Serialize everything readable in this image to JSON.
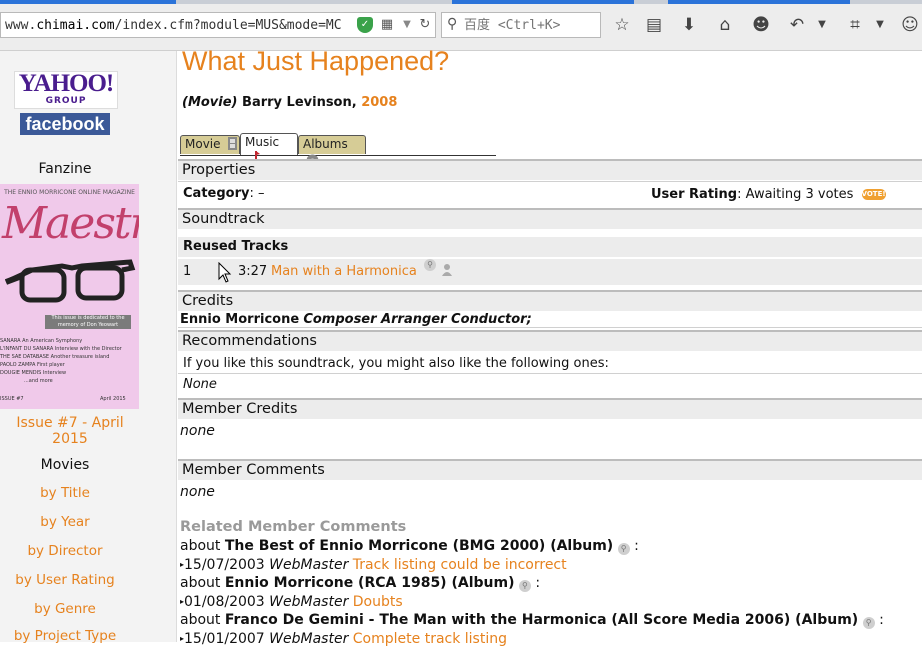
{
  "browser": {
    "url_prefix": "www.",
    "url_domain": "chimai.com",
    "url_rest": "/index.cfm?module=MUS&mode=MC",
    "search_placeholder": "百度 <Ctrl+K>",
    "search_icon": "search-icon"
  },
  "sidebar": {
    "yahoo_text": "YAHOO!",
    "yahoo_sub": "GROUP",
    "facebook_text": "facebook",
    "fanzine_title": "Fanzine",
    "cover": {
      "head": "THE ENNIO MORRICONE ONLINE MAGAZINE",
      "title": "Maestro",
      "box_text": "This issue is dedicated to the memory of Don Yeowart",
      "lines": [
        "SANARA An American Symphony",
        "L'INFANT DU SANARA Interview with the Director",
        "THE SAE DATABASE Another treasure island",
        "PAOLO ZAMPA First player",
        "DOUGIE MENDIS Interview"
      ],
      "more": "...and more",
      "issue": "ISSUE #7",
      "date": "April 2015"
    },
    "issue_link": "Issue #7 - April 2015",
    "movies_title": "Movies",
    "movies_links": [
      "by Title",
      "by Year",
      "by Director",
      "by User Rating",
      "by Genre",
      "by Project Type"
    ]
  },
  "main": {
    "title": "What Just Happened?",
    "kind": "(Movie)",
    "director": "Barry Levinson,",
    "year": "2008",
    "tabs": [
      {
        "label": "Movie",
        "active": false
      },
      {
        "label": "Music",
        "active": true
      },
      {
        "label": "Albums",
        "active": false
      }
    ],
    "properties": {
      "header": "Properties",
      "category_label": "Category",
      "category_value": ": –",
      "rating_label": "User Rating",
      "rating_value": ": Awaiting 3 votes",
      "vote_badge": "VOTE!"
    },
    "soundtrack": {
      "header": "Soundtrack",
      "reused_label": "Reused Tracks",
      "tracks": [
        {
          "number": "1",
          "duration": "3:27",
          "title": "Man with a Harmonica"
        }
      ]
    },
    "credits": {
      "header": "Credits",
      "name": "Ennio Morricone",
      "roles": "Composer Arranger Conductor;"
    },
    "recommendations": {
      "header": "Recommendations",
      "intro": "If you like this soundtrack, you might also like the following ones:",
      "value": "None"
    },
    "member_credits": {
      "header": "Member Credits",
      "value": "none"
    },
    "member_comments": {
      "header": "Member Comments",
      "value": "none"
    },
    "related": {
      "title": "Related Member Comments",
      "groups": [
        {
          "about": "about",
          "album": "The Best of Ennio Morricone (BMG 2000) (Album)",
          "date": "15/07/2003",
          "user": "WebMaster",
          "comment": "Track listing could be incorrect"
        },
        {
          "about": "about",
          "album": "Ennio Morricone (RCA 1985) (Album)",
          "date": "01/08/2003",
          "user": "WebMaster",
          "comment": "Doubts"
        },
        {
          "about": "about",
          "album": "Franco De Gemini - The Man with the Harmonica (All Score Media 2006) (Album)",
          "date": "15/01/2007",
          "user": "WebMaster",
          "comment": "Complete track listing"
        }
      ]
    }
  }
}
